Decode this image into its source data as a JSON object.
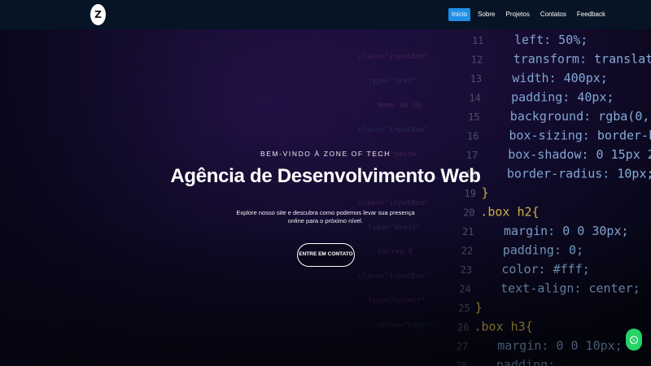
{
  "brand": {
    "logo_glyph": "Z"
  },
  "nav": {
    "items": [
      {
        "label": "Início",
        "active": true
      },
      {
        "label": "Sobre",
        "active": false
      },
      {
        "label": "Projetos",
        "active": false
      },
      {
        "label": "Contatos",
        "active": false
      },
      {
        "label": "Feedback",
        "active": false
      }
    ]
  },
  "hero": {
    "kicker": "BEM-VINDO À ZONE OF TECH",
    "title": "Agência de Desenvolvimento Web",
    "description": "Explore nosso site e descubra como podemos levar sua presença online para o próximo nível.",
    "cta_label": "ENTRE EM CONTATO"
  },
  "background_code": {
    "line_numbers": [
      "11",
      "12",
      "13",
      "14",
      "15",
      "16",
      "17",
      "18",
      "19",
      "20",
      "21",
      "22",
      "23",
      "24",
      "25",
      "26",
      "27",
      "28"
    ],
    "lines": [
      "left: 50%;",
      "transform: translate(-50%,",
      "width: 400px;",
      "padding: 40px;",
      "background: rgba(0, 0, 0,",
      "box-sizing: border-box;",
      "box-shadow: 0 15px 25px",
      "border-radius: 10px;",
      "}",
      ".box h2{",
      "margin: 0 0 30px;",
      "padding: 0;",
      "color: #fff;",
      "text-align: center;",
      "}",
      ".box h3{",
      "margin: 0 0 10px;",
      "padding:"
    ],
    "faint_left": [
      "class=\"inputBox\"",
      "type=\"text\"",
      "Nome de Us",
      "class=\"inputBox\"",
      "type=\"passw",
      "<h3>Senha</h3>",
      "class=\"inputBox\"",
      "type=\"email\"",
      "Correo E",
      "class=\"inputBox\"",
      "type=\"submit\"",
      "value=\"Login\""
    ]
  },
  "colors": {
    "accent": "#1e8fe6",
    "whatsapp": "#25d366",
    "navbar": "#061425"
  },
  "icons": {
    "whatsapp": "whatsapp-icon"
  }
}
